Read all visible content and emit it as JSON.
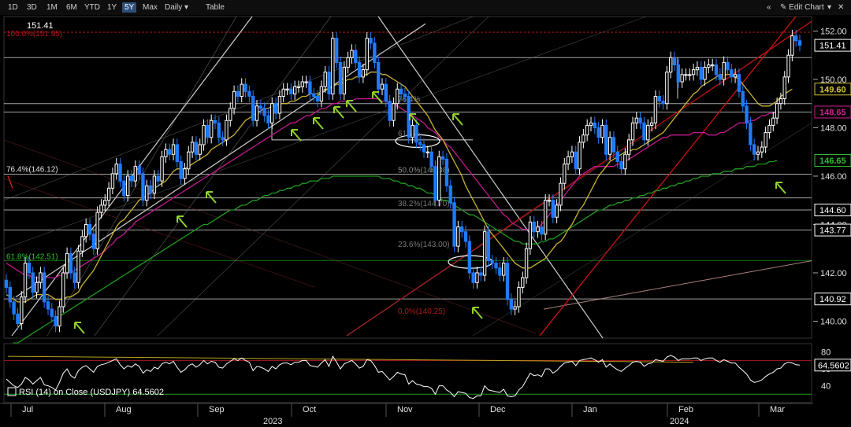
{
  "toolbar": {
    "ranges": [
      "1D",
      "3D",
      "1M",
      "6M",
      "YTD",
      "1Y",
      "5Y",
      "Max"
    ],
    "active_range": "5Y",
    "interval": "Daily",
    "table_label": "Table",
    "edit_chart_label": "Edit Chart"
  },
  "colors": {
    "bull": "#ffffff",
    "bear": "#1f7bff",
    "ma_short": "#c9b233",
    "ma_mid": "#c2188f",
    "ma_long": "#1f9a1f",
    "channel": "#d01010",
    "arrows": "#8fd12a",
    "rsi": "#ffffff"
  },
  "chart_data": [
    {
      "type": "candlestick",
      "title": "151.41",
      "last_price": 151.41,
      "ylim": [
        139.3,
        152.6
      ],
      "y_ticks": [
        152.0,
        150.0,
        148.0,
        146.0,
        144.0,
        142.0,
        140.0
      ],
      "x_labels": [
        "Jul",
        "Aug",
        "Sep",
        "Oct",
        "Nov",
        "Dec",
        "Jan",
        "Feb",
        "Mar"
      ],
      "year_labels": [
        "2023",
        "2024"
      ],
      "price_tags": [
        {
          "value": "151.41",
          "color": "#ffffff"
        },
        {
          "value": "149.60",
          "color": "#d4c23a"
        },
        {
          "value": "148.65",
          "color": "#d0208f"
        },
        {
          "value": "146.65",
          "color": "#2fbf2f"
        },
        {
          "value": "144.60",
          "color": "#ffffff"
        },
        {
          "value": "143.77",
          "color": "#ffffff"
        },
        {
          "value": "140.92",
          "color": "#ffffff"
        }
      ],
      "fib_labels": [
        {
          "text": "100.0%(151.95)",
          "value": 151.95
        },
        {
          "text": "76.4%(146.12)",
          "value": 146.12
        },
        {
          "text": "61.8%(142.51)",
          "value": 142.51
        },
        {
          "text": "76.4%",
          "value": 149.0
        },
        {
          "text": "61.8%",
          "value": 147.6
        },
        {
          "text": "50.0%(146.08)",
          "value": 146.08
        },
        {
          "text": "38.2%(144.70)",
          "value": 144.7
        },
        {
          "text": "23.6%(143.00)",
          "value": 143.0
        },
        {
          "text": "0.0%(140.25)",
          "value": 140.25
        }
      ],
      "horizontal_levels": [
        151.95,
        150.9,
        149.0,
        148.65,
        146.08,
        145.1,
        144.6,
        143.77,
        142.51,
        140.92
      ],
      "close": [
        141.4,
        140.8,
        140.3,
        139.9,
        141.0,
        142.4,
        142.0,
        141.2,
        141.6,
        142.0,
        140.8,
        140.5,
        140.2,
        139.8,
        140.6,
        142.0,
        142.8,
        142.0,
        141.6,
        142.9,
        143.5,
        144.0,
        143.6,
        143.0,
        144.5,
        144.8,
        145.0,
        145.5,
        146.1,
        146.5,
        145.8,
        145.2,
        146.0,
        145.8,
        146.4,
        146.1,
        145.0,
        145.6,
        145.3,
        146.0,
        145.8,
        146.8,
        147.1,
        146.9,
        147.3,
        146.6,
        145.9,
        146.3,
        147.0,
        147.4,
        146.9,
        147.3,
        148.1,
        147.6,
        148.3,
        148.2,
        147.6,
        147.5,
        148.3,
        148.8,
        149.5,
        149.3,
        149.8,
        149.5,
        149.3,
        148.3,
        148.9,
        148.8,
        148.5,
        148.2,
        149.0,
        148.6,
        149.3,
        149.6,
        149.6,
        149.4,
        149.7,
        149.7,
        149.9,
        149.9,
        149.4,
        149.3,
        149.1,
        149.7,
        150.3,
        149.4,
        151.7,
        150.7,
        149.4,
        150.5,
        150.9,
        151.2,
        150.7,
        150.1,
        150.4,
        151.7,
        151.5,
        150.7,
        149.6,
        149.8,
        149.1,
        148.3,
        149.0,
        149.6,
        149.4,
        149.3,
        147.6,
        148.1,
        147.4,
        147.3,
        147.0,
        147.0,
        146.4,
        145.0,
        146.8,
        146.7,
        145.6,
        144.9,
        143.1,
        143.9,
        143.7,
        143.3,
        142.0,
        141.6,
        142.0,
        141.9,
        143.7,
        142.5,
        142.4,
        142.2,
        141.9,
        142.4,
        140.9,
        140.5,
        140.6,
        141.4,
        141.8,
        143.0,
        144.1,
        143.7,
        143.9,
        143.6,
        145.0,
        145.0,
        144.3,
        144.8,
        145.7,
        146.5,
        146.8,
        147.0,
        146.3,
        147.4,
        147.7,
        148.1,
        148.2,
        148.0,
        147.6,
        148.1,
        146.9,
        147.6,
        147.0,
        146.6,
        146.3,
        146.9,
        147.5,
        148.2,
        148.4,
        148.2,
        147.5,
        148.1,
        148.2,
        149.3,
        149.1,
        149.0,
        150.3,
        150.9,
        150.6,
        149.9,
        150.2,
        150.2,
        150.2,
        150.4,
        150.5,
        150.0,
        150.5,
        150.6,
        150.6,
        150.2,
        150.0,
        150.7,
        150.4,
        150.1,
        150.2,
        149.5,
        148.9,
        148.2,
        147.3,
        146.9,
        147.0,
        147.2,
        147.8,
        148.1,
        148.4,
        149.0,
        149.2,
        150.1,
        151.0,
        151.8,
        151.6,
        151.41
      ],
      "ma_short": [
        141.1,
        141.0,
        140.9,
        140.8,
        140.8,
        140.8,
        140.9,
        141.0,
        141.1,
        141.1,
        141.1,
        141.1,
        141.0,
        140.9,
        140.9,
        140.9,
        141.0,
        141.0,
        141.1,
        141.2,
        141.5,
        141.7,
        141.9,
        142.1,
        142.4,
        142.7,
        143.0,
        143.3,
        143.6,
        143.9,
        144.1,
        144.2,
        144.4,
        144.6,
        144.8,
        145.0,
        145.1,
        145.2,
        145.3,
        145.5,
        145.6,
        145.7,
        145.8,
        146.0,
        146.2,
        146.3,
        146.3,
        146.3,
        146.4,
        146.5,
        146.6,
        146.7,
        146.8,
        146.9,
        147.1,
        147.2,
        147.3,
        147.4,
        147.5,
        147.6,
        147.7,
        147.9,
        148.1,
        148.3,
        148.4,
        148.5,
        148.6,
        148.7,
        148.8,
        148.8,
        148.9,
        148.9,
        149.0,
        149.0,
        149.0,
        149.1,
        149.1,
        149.2,
        149.3,
        149.3,
        149.4,
        149.4,
        149.4,
        149.5,
        149.6,
        149.6,
        149.7,
        149.8,
        149.8,
        149.9,
        150.0,
        150.0,
        150.1,
        150.1,
        150.2,
        150.2,
        150.3,
        150.3,
        150.3,
        150.2,
        150.2,
        150.1,
        150.0,
        149.9,
        149.8,
        149.7,
        149.5,
        149.3,
        149.1,
        148.9,
        148.7,
        148.5,
        148.2,
        147.9,
        147.7,
        147.5,
        147.2,
        146.9,
        146.6,
        146.3,
        146.0,
        145.6,
        145.3,
        145.0,
        144.7,
        144.4,
        144.1,
        143.8,
        143.6,
        143.4,
        143.2,
        143.0,
        142.8,
        142.6,
        142.4,
        142.3,
        142.2,
        142.2,
        142.2,
        142.3,
        142.4,
        142.5,
        142.6,
        142.8,
        143.0,
        143.2,
        143.3,
        143.5,
        143.8,
        144.0,
        144.3,
        144.6,
        144.8,
        145.1,
        145.4,
        145.7,
        146.0,
        146.2,
        146.4,
        146.6,
        146.7,
        146.8,
        146.9,
        147.0,
        147.0,
        147.1,
        147.1,
        147.2,
        147.3,
        147.4,
        147.5,
        147.6,
        147.7,
        147.8,
        148.0,
        148.2,
        148.4,
        148.6,
        148.8,
        149.0,
        149.2,
        149.4,
        149.5,
        149.7,
        149.8,
        149.9,
        150.0,
        150.1,
        150.2,
        150.2,
        150.2,
        150.2,
        150.1,
        150.0,
        149.8,
        149.6,
        149.4,
        149.2,
        149.0,
        148.9,
        148.9,
        148.9,
        149.0,
        149.1,
        149.3,
        149.4,
        149.5,
        149.6
      ],
      "ma_mid": [
        142.4,
        142.3,
        142.2,
        142.1,
        142.0,
        141.9,
        141.9,
        141.8,
        141.8,
        141.8,
        141.8,
        141.8,
        141.8,
        141.8,
        141.9,
        141.9,
        142.0,
        142.0,
        142.1,
        142.2,
        142.3,
        142.4,
        142.5,
        142.6,
        142.7,
        142.8,
        142.9,
        143.1,
        143.2,
        143.4,
        143.5,
        143.6,
        143.8,
        143.9,
        144.1,
        144.2,
        144.3,
        144.4,
        144.5,
        144.6,
        144.7,
        144.8,
        144.9,
        145.0,
        145.1,
        145.2,
        145.3,
        145.4,
        145.5,
        145.6,
        145.7,
        145.8,
        145.9,
        146.0,
        146.1,
        146.2,
        146.3,
        146.4,
        146.5,
        146.6,
        146.7,
        146.8,
        146.9,
        147.0,
        147.1,
        147.2,
        147.3,
        147.4,
        147.5,
        147.6,
        147.7,
        147.8,
        147.9,
        148.0,
        148.1,
        148.2,
        148.2,
        148.3,
        148.4,
        148.5,
        148.5,
        148.6,
        148.7,
        148.8,
        148.8,
        148.9,
        149.0,
        149.0,
        149.1,
        149.1,
        149.1,
        149.1,
        149.2,
        149.2,
        149.2,
        149.2,
        149.2,
        149.2,
        149.2,
        149.1,
        149.1,
        149.0,
        149.0,
        148.9,
        148.8,
        148.7,
        148.6,
        148.5,
        148.4,
        148.3,
        148.2,
        148.0,
        147.9,
        147.8,
        147.6,
        147.5,
        147.3,
        147.2,
        147.0,
        146.8,
        146.6,
        146.4,
        146.2,
        146.0,
        145.8,
        145.6,
        145.4,
        145.2,
        145.0,
        144.8,
        144.6,
        144.4,
        144.3,
        144.1,
        144.0,
        143.9,
        143.8,
        143.8,
        143.8,
        143.8,
        143.9,
        144.0,
        144.2,
        144.4,
        144.6,
        144.8,
        145.0,
        145.2,
        145.4,
        145.6,
        145.8,
        146.0,
        146.1,
        146.2,
        146.3,
        146.4,
        146.4,
        146.4,
        146.4,
        146.4,
        146.4,
        146.5,
        146.5,
        146.6,
        146.7,
        146.8,
        146.9,
        147.0,
        147.1,
        147.2,
        147.3,
        147.4,
        147.5,
        147.6,
        147.6,
        147.7,
        147.7,
        147.7,
        147.7,
        147.7,
        147.7,
        147.8,
        147.8,
        147.8,
        147.8,
        147.7,
        147.7,
        147.7,
        147.8,
        147.8,
        147.9,
        148.0,
        148.1,
        148.2,
        148.2,
        148.2,
        148.3,
        148.3,
        148.4,
        148.5,
        148.5,
        148.6,
        148.6,
        148.65
      ],
      "ma_long": [
        139.0,
        139.0,
        139.1,
        139.1,
        139.2,
        139.3,
        139.4,
        139.5,
        139.6,
        139.7,
        139.8,
        139.9,
        140.0,
        140.1,
        140.2,
        140.3,
        140.4,
        140.5,
        140.6,
        140.7,
        140.8,
        140.9,
        141.0,
        141.1,
        141.2,
        141.3,
        141.4,
        141.5,
        141.6,
        141.7,
        141.8,
        141.9,
        142.0,
        142.1,
        142.2,
        142.3,
        142.4,
        142.5,
        142.6,
        142.7,
        142.8,
        142.9,
        143.0,
        143.1,
        143.2,
        143.3,
        143.4,
        143.5,
        143.6,
        143.7,
        143.8,
        143.9,
        144.0,
        144.0,
        144.1,
        144.2,
        144.3,
        144.4,
        144.5,
        144.6,
        144.6,
        144.7,
        144.8,
        144.8,
        144.9,
        145.0,
        145.0,
        145.1,
        145.2,
        145.2,
        145.3,
        145.3,
        145.4,
        145.4,
        145.5,
        145.5,
        145.6,
        145.6,
        145.7,
        145.7,
        145.8,
        145.8,
        145.8,
        145.9,
        145.9,
        145.9,
        146.0,
        146.0,
        146.0,
        146.0,
        146.0,
        146.0,
        146.0,
        146.0,
        146.0,
        146.0,
        146.0,
        146.0,
        146.0,
        145.9,
        145.9,
        145.9,
        145.8,
        145.8,
        145.7,
        145.7,
        145.6,
        145.6,
        145.5,
        145.5,
        145.4,
        145.3,
        145.3,
        145.2,
        145.1,
        145.0,
        145.0,
        144.9,
        144.8,
        144.7,
        144.6,
        144.5,
        144.4,
        144.4,
        144.3,
        144.2,
        144.1,
        144.0,
        143.9,
        143.8,
        143.7,
        143.6,
        143.5,
        143.4,
        143.3,
        143.3,
        143.2,
        143.2,
        143.2,
        143.2,
        143.2,
        143.3,
        143.3,
        143.4,
        143.4,
        143.5,
        143.6,
        143.7,
        143.8,
        143.9,
        144.0,
        144.1,
        144.2,
        144.3,
        144.4,
        144.5,
        144.6,
        144.6,
        144.7,
        144.8,
        144.8,
        144.9,
        144.9,
        145.0,
        145.0,
        145.1,
        145.1,
        145.2,
        145.2,
        145.3,
        145.3,
        145.4,
        145.4,
        145.5,
        145.5,
        145.6,
        145.6,
        145.7,
        145.7,
        145.8,
        145.8,
        145.9,
        145.9,
        146.0,
        146.0,
        146.0,
        146.1,
        146.1,
        146.1,
        146.2,
        146.2,
        146.2,
        146.3,
        146.3,
        146.3,
        146.4,
        146.4,
        146.4,
        146.5,
        146.5,
        146.5,
        146.6,
        146.6,
        146.65
      ]
    },
    {
      "type": "line",
      "legend": "RSI (14)  on Close (USDJPY) 64.5602",
      "last_value": "64.5602",
      "ylim": [
        20,
        90
      ],
      "y_ticks": [
        80,
        60,
        40
      ],
      "rsi": [
        48,
        44,
        40,
        38,
        42,
        50,
        47,
        42,
        46,
        50,
        41,
        40,
        38,
        35,
        44,
        55,
        60,
        52,
        49,
        58,
        62,
        64,
        60,
        56,
        63,
        65,
        66,
        68,
        70,
        72,
        65,
        60,
        64,
        62,
        66,
        63,
        55,
        59,
        57,
        62,
        60,
        66,
        68,
        66,
        69,
        62,
        56,
        59,
        64,
        66,
        62,
        65,
        70,
        66,
        69,
        68,
        62,
        61,
        66,
        69,
        72,
        70,
        73,
        70,
        68,
        58,
        63,
        62,
        60,
        57,
        63,
        60,
        65,
        67,
        67,
        65,
        68,
        68,
        70,
        70,
        64,
        63,
        62,
        67,
        71,
        63,
        75,
        68,
        60,
        66,
        68,
        70,
        66,
        61,
        63,
        71,
        70,
        64,
        56,
        57,
        52,
        47,
        51,
        56,
        54,
        53,
        42,
        46,
        42,
        41,
        39,
        39,
        37,
        30,
        40,
        40,
        35,
        32,
        27,
        33,
        32,
        31,
        26,
        25,
        28,
        28,
        40,
        35,
        34,
        33,
        32,
        36,
        28,
        27,
        28,
        35,
        39,
        47,
        55,
        52,
        53,
        51,
        60,
        60,
        55,
        58,
        63,
        67,
        68,
        69,
        64,
        70,
        71,
        72,
        73,
        71,
        68,
        71,
        62,
        66,
        62,
        59,
        57,
        61,
        64,
        68,
        69,
        68,
        63,
        66,
        67,
        71,
        70,
        69,
        74,
        76,
        74,
        70,
        72,
        72,
        72,
        73,
        73,
        70,
        72,
        73,
        73,
        70,
        68,
        71,
        69,
        67,
        67,
        62,
        58,
        54,
        47,
        44,
        45,
        47,
        51,
        54,
        56,
        60,
        61,
        66,
        68,
        67,
        65,
        64.56
      ]
    }
  ],
  "annotations": {
    "year_2023": "2023",
    "year_2024": "2024"
  }
}
